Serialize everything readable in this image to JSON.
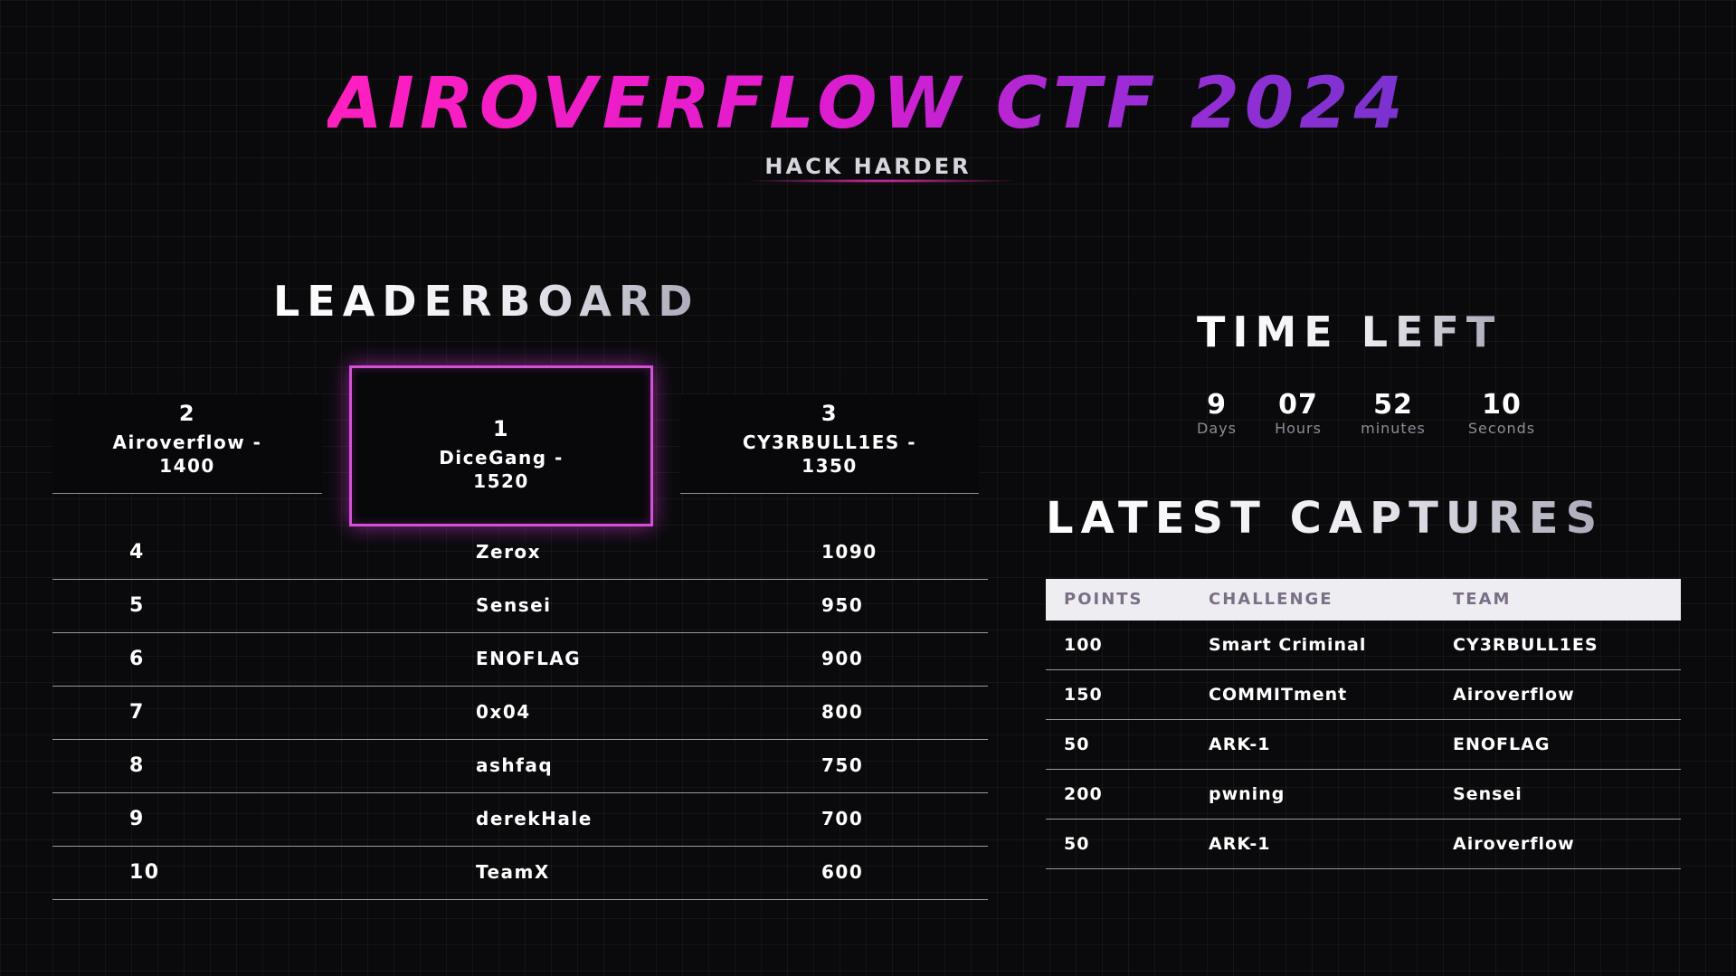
{
  "header": {
    "title": "AIROVERFLOW CTF 2024",
    "tagline": "HACK HARDER"
  },
  "leaderboard": {
    "title": "LEADERBOARD",
    "podium": [
      {
        "rank": "1",
        "team": "DiceGang -",
        "score": "1520"
      },
      {
        "rank": "2",
        "team": "Airoverflow -",
        "score": "1400"
      },
      {
        "rank": "3",
        "team": "CY3RBULL1ES -",
        "score": "1350"
      }
    ],
    "rows": [
      {
        "rank": "4",
        "team": "Zerox",
        "score": "1090"
      },
      {
        "rank": "5",
        "team": "Sensei",
        "score": "950"
      },
      {
        "rank": "6",
        "team": "ENOFLAG",
        "score": "900"
      },
      {
        "rank": "7",
        "team": "0x04",
        "score": "800"
      },
      {
        "rank": "8",
        "team": "ashfaq",
        "score": "750"
      },
      {
        "rank": "9",
        "team": "derekHale",
        "score": "700"
      },
      {
        "rank": "10",
        "team": "TeamX",
        "score": "600"
      }
    ]
  },
  "timer": {
    "title": "TIME LEFT",
    "units": [
      {
        "value": "9",
        "label": "Days"
      },
      {
        "value": "07",
        "label": "Hours"
      },
      {
        "value": "52",
        "label": "minutes"
      },
      {
        "value": "10",
        "label": "Seconds"
      }
    ]
  },
  "captures": {
    "title": "LATEST CAPTURES",
    "columns": [
      "POINTS",
      "CHALLENGE",
      "TEAM"
    ],
    "rows": [
      {
        "points": "100",
        "challenge": "Smart Criminal",
        "team": "CY3RBULL1ES"
      },
      {
        "points": "150",
        "challenge": "COMMITment",
        "team": "Airoverflow"
      },
      {
        "points": "50",
        "challenge": "ARK-1",
        "team": "ENOFLAG"
      },
      {
        "points": "200",
        "challenge": "pwning",
        "team": "Sensei"
      },
      {
        "points": "50",
        "challenge": "ARK-1",
        "team": "Airoverflow"
      }
    ]
  },
  "colors": {
    "accent_pink": "#ff1fbf",
    "accent_purple": "#7a33cf",
    "podium_border": "#d64fd9",
    "background": "#0a0a0c"
  }
}
